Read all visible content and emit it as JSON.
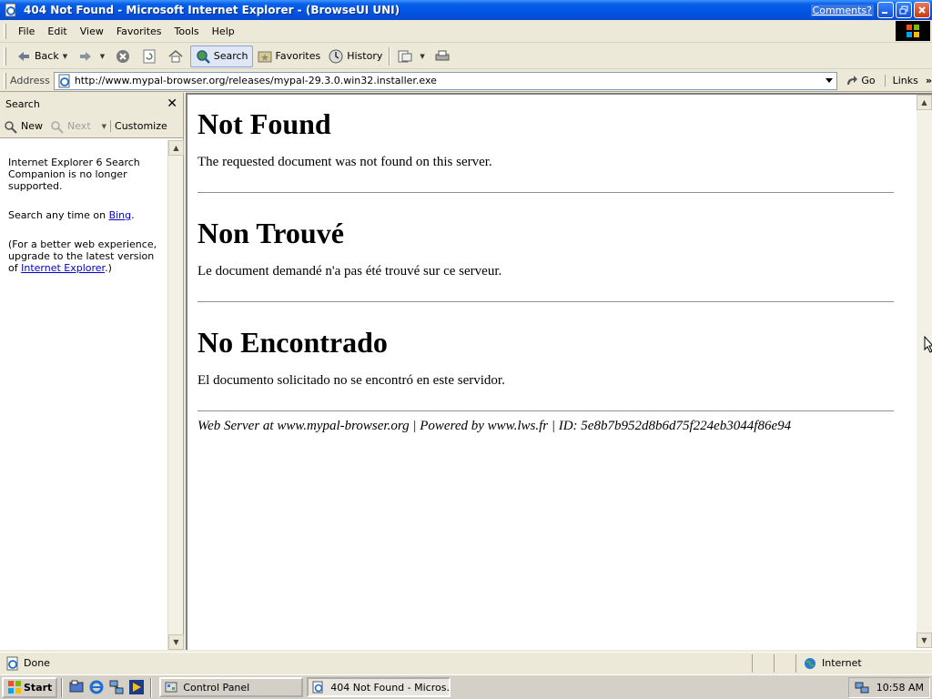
{
  "window": {
    "title": "404 Not Found - Microsoft Internet Explorer - (BrowseUI UNI)",
    "comments_link": "Comments?"
  },
  "menubar": {
    "items": [
      "File",
      "Edit",
      "View",
      "Favorites",
      "Tools",
      "Help"
    ]
  },
  "toolbar": {
    "back_label": "Back",
    "search_label": "Search",
    "favorites_label": "Favorites",
    "history_label": "History"
  },
  "addressbar": {
    "label": "Address",
    "url": "http://www.mypal-browser.org/releases/mypal-29.3.0.win32.installer.exe",
    "go_label": "Go",
    "links_label": "Links"
  },
  "search_pane": {
    "title": "Search",
    "new_label": "New",
    "next_label": "Next",
    "customize_label": "Customize",
    "msg1": "Internet Explorer 6 Search Companion is no longer supported.",
    "msg2_prefix": "Search any time on ",
    "msg2_link": "Bing",
    "msg2_suffix": ".",
    "msg3_prefix": "(For a better web experience, upgrade to the latest version of ",
    "msg3_link": "Internet Explorer",
    "msg3_suffix": ".)"
  },
  "page": {
    "sections": [
      {
        "heading": "Not Found",
        "text": "The requested document was not found on this server."
      },
      {
        "heading": "Non Trouvé",
        "text": "Le document demandé n'a pas été trouvé sur ce serveur."
      },
      {
        "heading": "No Encontrado",
        "text": "El documento solicitado no se encontró en este servidor."
      }
    ],
    "footer": "Web Server at www.mypal-browser.org | Powered by www.lws.fr | ID: 5e8b7b952d8b6d75f224eb3044f86e94"
  },
  "statusbar": {
    "status": "Done",
    "zone": "Internet"
  },
  "taskbar": {
    "start_label": "Start",
    "tasks": [
      "Control Panel",
      "404 Not Found - Micros..."
    ],
    "clock": "10:58 AM"
  }
}
